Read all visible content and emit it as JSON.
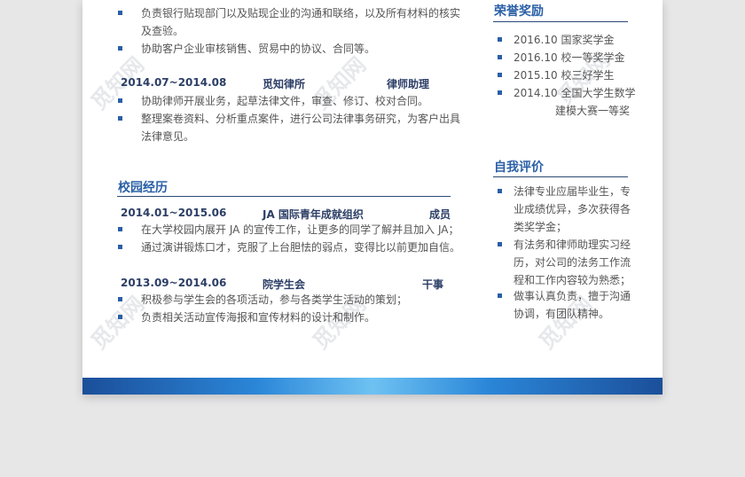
{
  "watermark": "觅知网",
  "experience": {
    "bullets_top": [
      [
        "负责银行贴现部门以及贴现企业的沟通和联络，以及所有材料的核实",
        "及查验。"
      ],
      [
        "协助客户企业审核销售、贸易中的协议、合同等。"
      ]
    ],
    "job2": {
      "period": "2014.07~2014.08",
      "org": "觅知律所",
      "role": "律师助理"
    },
    "job2_bullets": [
      [
        "协助律师开展业务，起草法律文件，审查、修订、校对合同。"
      ],
      [
        "整理案卷资料、分析重点案件，进行公司法律事务研究，为客户出具",
        "法律意见。"
      ]
    ]
  },
  "campus": {
    "title": "校园经历",
    "job1": {
      "period": "2014.01~2015.06",
      "org": "JA 国际青年成就组织",
      "role": "成员"
    },
    "job1_bullets": [
      [
        "在大学校园内展开 JA 的宣传工作，让更多的同学了解并且加入 JA；"
      ],
      [
        "通过演讲锻炼口才，克服了上台胆怯的弱点，变得比以前更加自信。"
      ]
    ],
    "job2": {
      "period": "2013.09~2014.06",
      "org": "院学生会",
      "role": "干事"
    },
    "job2_bullets": [
      [
        "积极参与学生会的各项活动，参与各类学生活动的策划；"
      ],
      [
        "负责相关活动宣传海报和宣传材料的设计和制作。"
      ]
    ]
  },
  "honors": {
    "title": "荣誉奖励",
    "items": [
      [
        "2016.10 国家奖学金"
      ],
      [
        "2016.10 校一等奖学金"
      ],
      [
        "2015.10 校三好学生"
      ],
      [
        "2014.10 全国大学生数学",
        "建模大赛一等奖"
      ]
    ]
  },
  "self_eval": {
    "title": "自我评价",
    "items": [
      [
        "法律专业应届毕业生，专",
        "业成绩优异，多次获得各",
        "类奖学金；"
      ],
      [
        "有法务和律师助理实习经",
        "历，对公司的法务工作流",
        "程和工作内容较为熟悉；"
      ],
      [
        "做事认真负责，擅于沟通",
        "协调，有团队精神。"
      ]
    ]
  },
  "colors": {
    "accent": "#2a5fa6",
    "heading": "#2c3e66",
    "text": "#555555",
    "band": "#2b86d8"
  }
}
